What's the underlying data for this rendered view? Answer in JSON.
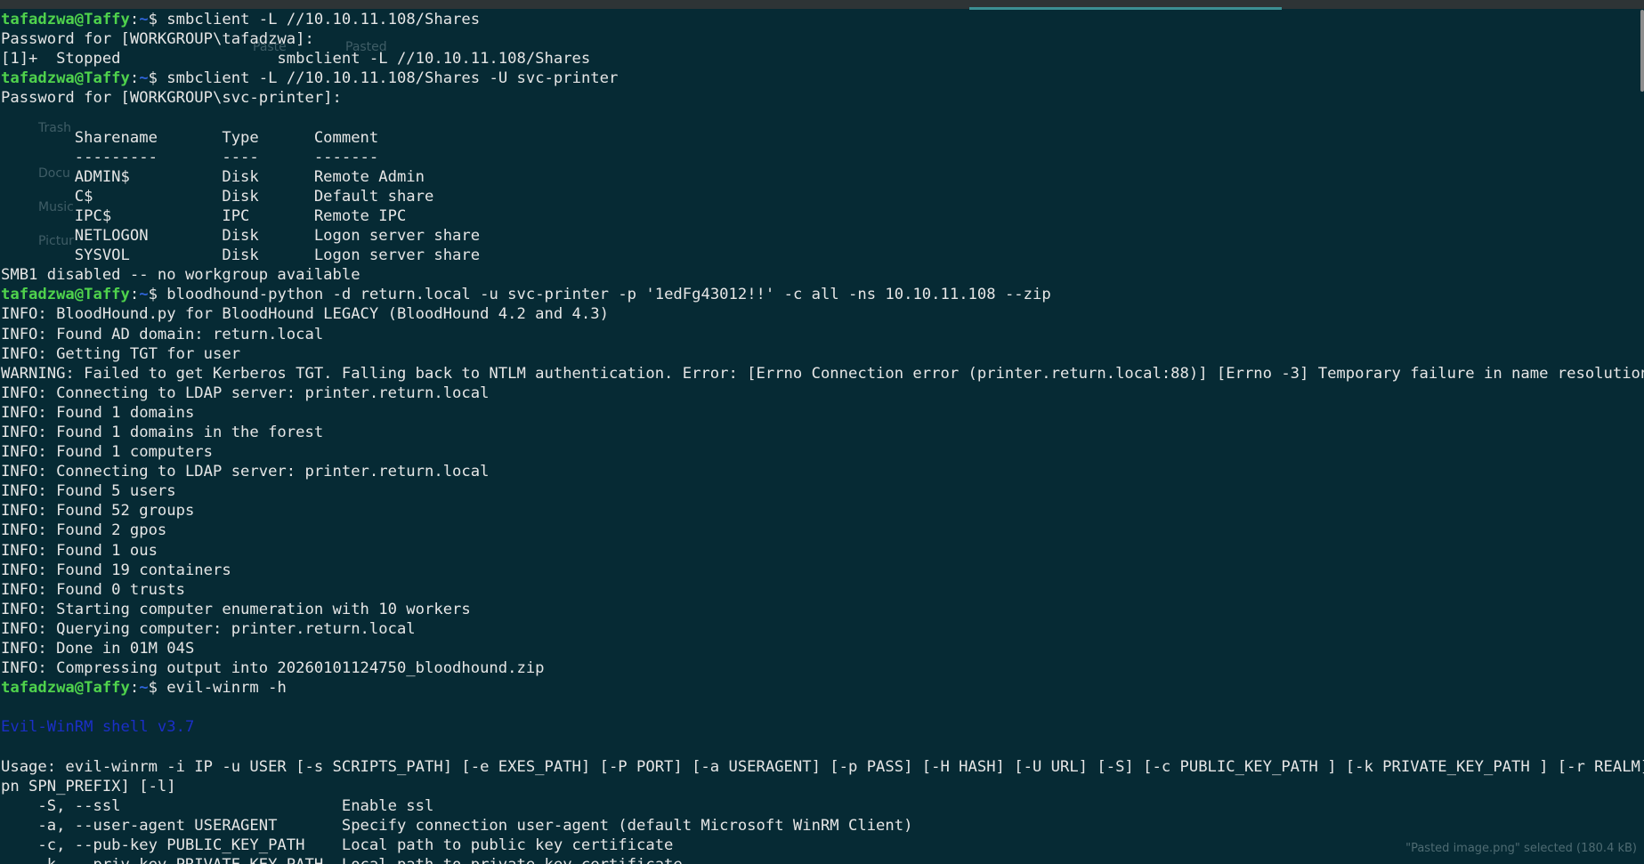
{
  "prompt": {
    "user": "tafadzwa@Taffy",
    "path": "~",
    "symbol": "$ "
  },
  "terminal": {
    "lines": [
      {
        "type": "prompt",
        "cmd": "smbclient -L //10.10.11.108/Shares"
      },
      {
        "type": "text",
        "text": "Password for [WORKGROUP\\tafadzwa]:"
      },
      {
        "type": "text",
        "text": "[1]+  Stopped                 smbclient -L //10.10.11.108/Shares"
      },
      {
        "type": "prompt",
        "cmd": "smbclient -L //10.10.11.108/Shares -U svc-printer"
      },
      {
        "type": "text",
        "text": "Password for [WORKGROUP\\svc-printer]:"
      },
      {
        "type": "text",
        "text": ""
      },
      {
        "type": "text",
        "text": "        Sharename       Type      Comment"
      },
      {
        "type": "text",
        "text": "        ---------       ----      -------"
      },
      {
        "type": "text",
        "text": "        ADMIN$          Disk      Remote Admin"
      },
      {
        "type": "text",
        "text": "        C$              Disk      Default share"
      },
      {
        "type": "text",
        "text": "        IPC$            IPC       Remote IPC"
      },
      {
        "type": "text",
        "text": "        NETLOGON        Disk      Logon server share"
      },
      {
        "type": "text",
        "text": "        SYSVOL          Disk      Logon server share"
      },
      {
        "type": "text",
        "text": "SMB1 disabled -- no workgroup available"
      },
      {
        "type": "prompt",
        "cmd": "bloodhound-python -d return.local -u svc-printer -p '1edFg43012!!' -c all -ns 10.10.11.108 --zip"
      },
      {
        "type": "text",
        "text": "INFO: BloodHound.py for BloodHound LEGACY (BloodHound 4.2 and 4.3)"
      },
      {
        "type": "text",
        "text": "INFO: Found AD domain: return.local"
      },
      {
        "type": "text",
        "text": "INFO: Getting TGT for user"
      },
      {
        "type": "text",
        "text": "WARNING: Failed to get Kerberos TGT. Falling back to NTLM authentication. Error: [Errno Connection error (printer.return.local:88)] [Errno -3] Temporary failure in name resolution"
      },
      {
        "type": "text",
        "text": "INFO: Connecting to LDAP server: printer.return.local"
      },
      {
        "type": "text",
        "text": "INFO: Found 1 domains"
      },
      {
        "type": "text",
        "text": "INFO: Found 1 domains in the forest"
      },
      {
        "type": "text",
        "text": "INFO: Found 1 computers"
      },
      {
        "type": "text",
        "text": "INFO: Connecting to LDAP server: printer.return.local"
      },
      {
        "type": "text",
        "text": "INFO: Found 5 users"
      },
      {
        "type": "text",
        "text": "INFO: Found 52 groups"
      },
      {
        "type": "text",
        "text": "INFO: Found 2 gpos"
      },
      {
        "type": "text",
        "text": "INFO: Found 1 ous"
      },
      {
        "type": "text",
        "text": "INFO: Found 19 containers"
      },
      {
        "type": "text",
        "text": "INFO: Found 0 trusts"
      },
      {
        "type": "text",
        "text": "INFO: Starting computer enumeration with 10 workers"
      },
      {
        "type": "text",
        "text": "INFO: Querying computer: printer.return.local"
      },
      {
        "type": "text",
        "text": "INFO: Done in 01M 04S"
      },
      {
        "type": "text",
        "text": "INFO: Compressing output into 20260101124750_bloodhound.zip"
      },
      {
        "type": "prompt",
        "cmd": "evil-winrm -h"
      },
      {
        "type": "text",
        "text": ""
      },
      {
        "type": "banner",
        "text": "Evil-WinRM shell v3.7"
      },
      {
        "type": "text",
        "text": ""
      },
      {
        "type": "text",
        "text": "Usage: evil-winrm -i IP -u USER [-s SCRIPTS_PATH] [-e EXES_PATH] [-P PORT] [-a USERAGENT] [-p PASS] [-H HASH] [-U URL] [-S] [-c PUBLIC_KEY_PATH ] [-k PRIVATE_KEY_PATH ] [-r REALM] [--s"
      },
      {
        "type": "text",
        "text": "pn SPN_PREFIX] [-l]"
      },
      {
        "type": "text",
        "text": "    -S, --ssl                        Enable ssl"
      },
      {
        "type": "text",
        "text": "    -a, --user-agent USERAGENT       Specify connection user-agent (default Microsoft WinRM Client)"
      },
      {
        "type": "text",
        "text": "    -c, --pub-key PUBLIC_KEY_PATH    Local path to public key certificate"
      },
      {
        "type": "text",
        "text": "    -k, --priv-key PRIVATE_KEY_PATH  Local path to private key certificate"
      }
    ]
  },
  "ghost": {
    "trash": "Trash",
    "documents": "Docu",
    "music": "Music",
    "pictures": "Pictur",
    "pasted1": "Paste",
    "pasted2": "Pasted",
    "status": "\"Pasted image.png\" selected  (180.4 kB)"
  }
}
